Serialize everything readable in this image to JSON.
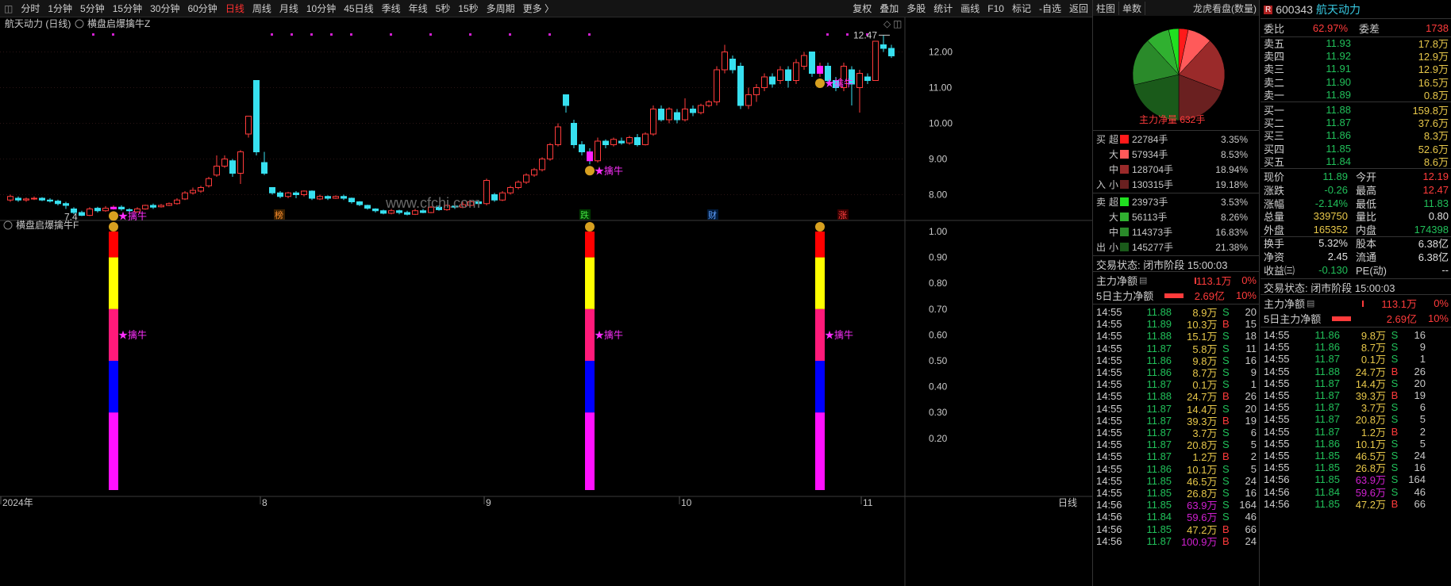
{
  "toolbar": {
    "periods": [
      "分时",
      "1分钟",
      "5分钟",
      "15分钟",
      "30分钟",
      "60分钟",
      "日线",
      "周线",
      "月线",
      "10分钟",
      "45日线",
      "季线",
      "年线",
      "5秒",
      "15秒",
      "多周期",
      "更多 〉"
    ],
    "active_index": 6,
    "right": [
      "复权",
      "叠加",
      "多股",
      "统计",
      "画线",
      "F10",
      "标记",
      "-自选",
      "返回"
    ]
  },
  "chart": {
    "title": "航天动力 (日线)",
    "indicator_main": "横盘启爆擒牛Z",
    "indicator_sub": "横盘启爆擒牛F",
    "signal_label": "★擒牛",
    "price_ticks": [
      "12.00",
      "11.00",
      "10.00",
      "9.00",
      "8.00"
    ],
    "sub_ticks": [
      "1.00",
      "0.90",
      "0.80",
      "0.70",
      "0.60",
      "0.50",
      "0.40",
      "0.30",
      "0.20"
    ],
    "x_labels": [
      "2024年",
      "8",
      "9",
      "10",
      "11"
    ],
    "period_label": "日线",
    "high_label": "12.47",
    "low_label": "7.4",
    "markers": [
      "榜",
      "跌",
      "财",
      "涨"
    ],
    "watermark": "www.cfchi.com"
  },
  "pie_panel": {
    "tabs": [
      "柱图",
      "单数"
    ],
    "title": "龙虎看盘(数量)",
    "net_label": "主力净量 632手"
  },
  "flow": {
    "buy_side": "买",
    "in_side": "入",
    "sell_side": "卖",
    "out_side": "出",
    "buy": [
      {
        "t": "超",
        "v": "22784手",
        "p": "3.35%",
        "c": "#ff1a1a"
      },
      {
        "t": "大",
        "v": "57934手",
        "p": "8.53%",
        "c": "#ff5a5a"
      },
      {
        "t": "中",
        "v": "128704手",
        "p": "18.94%",
        "c": "#9a2a2a"
      },
      {
        "t": "小",
        "v": "130315手",
        "p": "19.18%",
        "c": "#6a2020"
      }
    ],
    "sell": [
      {
        "t": "超",
        "v": "23973手",
        "p": "3.53%",
        "c": "#20e020"
      },
      {
        "t": "大",
        "v": "56113手",
        "p": "8.26%",
        "c": "#30b030"
      },
      {
        "t": "中",
        "v": "114373手",
        "p": "16.83%",
        "c": "#2a8a2a"
      },
      {
        "t": "小",
        "v": "145277手",
        "p": "21.38%",
        "c": "#1a5a1a"
      }
    ]
  },
  "mid_status": {
    "state": "交易状态: 闭市阶段 15:00:03",
    "net_label": "主力净额",
    "net_val": "113.1万",
    "net_pct": "0%",
    "net5_label": "5日主力净额",
    "net5_val": "2.69亿",
    "net5_pct": "10%"
  },
  "ticks_mid": [
    [
      "14:55",
      "11.88",
      "8.9万",
      "S",
      "20"
    ],
    [
      "14:55",
      "11.89",
      "10.3万",
      "B",
      "15"
    ],
    [
      "14:55",
      "11.88",
      "15.1万",
      "S",
      "18"
    ],
    [
      "14:55",
      "11.87",
      "5.8万",
      "S",
      "11"
    ],
    [
      "14:55",
      "11.86",
      "9.8万",
      "S",
      "16"
    ],
    [
      "14:55",
      "11.86",
      "8.7万",
      "S",
      "9"
    ],
    [
      "14:55",
      "11.87",
      "0.1万",
      "S",
      "1"
    ],
    [
      "14:55",
      "11.88",
      "24.7万",
      "B",
      "26"
    ],
    [
      "14:55",
      "11.87",
      "14.4万",
      "S",
      "20"
    ],
    [
      "14:55",
      "11.87",
      "39.3万",
      "B",
      "19"
    ],
    [
      "14:55",
      "11.87",
      "3.7万",
      "S",
      "6"
    ],
    [
      "14:55",
      "11.87",
      "20.8万",
      "S",
      "5"
    ],
    [
      "14:55",
      "11.87",
      "1.2万",
      "B",
      "2"
    ],
    [
      "14:55",
      "11.86",
      "10.1万",
      "S",
      "5"
    ],
    [
      "14:55",
      "11.85",
      "46.5万",
      "S",
      "24"
    ],
    [
      "14:55",
      "11.85",
      "26.8万",
      "S",
      "16"
    ],
    [
      "14:56",
      "11.85",
      "63.9万",
      "S",
      "164"
    ],
    [
      "14:56",
      "11.84",
      "59.6万",
      "S",
      "46"
    ],
    [
      "14:56",
      "11.85",
      "47.2万",
      "B",
      "66"
    ],
    [
      "14:56",
      "11.87",
      "100.9万",
      "B",
      "24"
    ]
  ],
  "stock": {
    "marker": "R",
    "code": "600343",
    "name": "航天动力",
    "weibi_label": "委比",
    "weibi": "62.97%",
    "weicha_label": "委差",
    "weicha": "1738"
  },
  "asks": [
    [
      "卖五",
      "11.93",
      "17.8万"
    ],
    [
      "卖四",
      "11.92",
      "12.9万"
    ],
    [
      "卖三",
      "11.91",
      "12.9万"
    ],
    [
      "卖二",
      "11.90",
      "16.5万"
    ],
    [
      "卖一",
      "11.89",
      "0.8万"
    ]
  ],
  "bids": [
    [
      "买一",
      "11.88",
      "159.8万"
    ],
    [
      "买二",
      "11.87",
      "37.6万"
    ],
    [
      "买三",
      "11.86",
      "8.3万"
    ],
    [
      "买四",
      "11.85",
      "52.6万"
    ],
    [
      "买五",
      "11.84",
      "8.6万"
    ]
  ],
  "quote": [
    [
      "现价",
      "11.89",
      "今开",
      "12.19"
    ],
    [
      "涨跌",
      "-0.26",
      "最高",
      "12.47"
    ],
    [
      "涨幅",
      "-2.14%",
      "最低",
      "11.83"
    ],
    [
      "总量",
      "339750",
      "量比",
      "0.80"
    ],
    [
      "外盘",
      "165352",
      "内盘",
      "174398"
    ],
    [
      "换手",
      "5.32%",
      "股本",
      "6.38亿"
    ],
    [
      "净资",
      "2.45",
      "流通",
      "6.38亿"
    ],
    [
      "收益㈢",
      "-0.130",
      "PE(动)",
      "--"
    ]
  ],
  "right_status": {
    "state": "交易状态: 闭市阶段 15:00:03",
    "net_label": "主力净额",
    "net_val": "113.1万",
    "net_pct": "0%",
    "net5_label": "5日主力净额",
    "net5_val": "2.69亿",
    "net5_pct": "10%"
  },
  "ticks_right": [
    [
      "14:55",
      "11.86",
      "9.8万",
      "S",
      "16"
    ],
    [
      "14:55",
      "11.86",
      "8.7万",
      "S",
      "9"
    ],
    [
      "14:55",
      "11.87",
      "0.1万",
      "S",
      "1"
    ],
    [
      "14:55",
      "11.88",
      "24.7万",
      "B",
      "26"
    ],
    [
      "14:55",
      "11.87",
      "14.4万",
      "S",
      "20"
    ],
    [
      "14:55",
      "11.87",
      "39.3万",
      "B",
      "19"
    ],
    [
      "14:55",
      "11.87",
      "3.7万",
      "S",
      "6"
    ],
    [
      "14:55",
      "11.87",
      "20.8万",
      "S",
      "5"
    ],
    [
      "14:55",
      "11.87",
      "1.2万",
      "B",
      "2"
    ],
    [
      "14:55",
      "11.86",
      "10.1万",
      "S",
      "5"
    ],
    [
      "14:55",
      "11.85",
      "46.5万",
      "S",
      "24"
    ],
    [
      "14:55",
      "11.85",
      "26.8万",
      "S",
      "16"
    ],
    [
      "14:56",
      "11.85",
      "63.9万",
      "S",
      "164"
    ],
    [
      "14:56",
      "11.84",
      "59.6万",
      "S",
      "46"
    ],
    [
      "14:56",
      "11.85",
      "47.2万",
      "B",
      "66"
    ]
  ],
  "chart_data": {
    "type": "candlestick",
    "ylim": [
      7.3,
      12.7
    ],
    "candles": [
      [
        7.85,
        7.95,
        8.0,
        7.8
      ],
      [
        7.9,
        7.85,
        7.95,
        7.8
      ],
      [
        7.85,
        7.88,
        7.92,
        7.8
      ],
      [
        7.88,
        7.9,
        7.95,
        7.85
      ],
      [
        7.9,
        7.85,
        7.93,
        7.82
      ],
      [
        7.85,
        7.82,
        7.9,
        7.78
      ],
      [
        7.82,
        7.75,
        7.86,
        7.7
      ],
      [
        7.75,
        7.7,
        7.8,
        7.6
      ],
      [
        7.6,
        7.5,
        7.65,
        7.45
      ],
      [
        7.5,
        7.42,
        7.55,
        7.4
      ],
      [
        7.42,
        7.6,
        7.65,
        7.4
      ],
      [
        7.62,
        7.55,
        7.66,
        7.5
      ],
      [
        7.55,
        7.62,
        7.68,
        7.52
      ],
      [
        7.6,
        7.65,
        7.7,
        7.58
      ],
      [
        7.65,
        7.6,
        7.7,
        7.55
      ],
      [
        7.58,
        7.55,
        7.62,
        7.5
      ],
      [
        7.52,
        7.6,
        7.65,
        7.5
      ],
      [
        7.6,
        7.7,
        7.72,
        7.58
      ],
      [
        7.7,
        7.65,
        7.75,
        7.6
      ],
      [
        7.66,
        7.7,
        7.74,
        7.64
      ],
      [
        7.7,
        7.75,
        7.78,
        7.68
      ],
      [
        7.75,
        7.85,
        7.9,
        7.72
      ],
      [
        7.88,
        8.05,
        8.1,
        7.85
      ],
      [
        8.05,
        8.12,
        8.2,
        8.0
      ],
      [
        8.1,
        8.2,
        8.25,
        8.05
      ],
      [
        8.25,
        8.45,
        8.5,
        8.2
      ],
      [
        8.55,
        8.8,
        9.1,
        8.5
      ],
      [
        8.8,
        9.0,
        9.1,
        8.75
      ],
      [
        8.95,
        8.6,
        9.0,
        8.5
      ],
      [
        8.6,
        9.2,
        9.25,
        8.3
      ],
      [
        9.7,
        10.2,
        10.2,
        9.6
      ],
      [
        11.2,
        9.2,
        11.2,
        9.1
      ],
      [
        8.9,
        8.6,
        9.2,
        8.55
      ],
      [
        8.2,
        8.05,
        8.2,
        8.0
      ],
      [
        8.05,
        7.95,
        8.1,
        7.9
      ],
      [
        7.95,
        8.05,
        8.08,
        7.9
      ],
      [
        8.05,
        8.0,
        8.1,
        7.9
      ],
      [
        8.0,
        8.1,
        8.12,
        7.95
      ],
      [
        8.1,
        7.9,
        8.12,
        7.85
      ],
      [
        7.88,
        7.95,
        8.0,
        7.85
      ],
      [
        7.95,
        7.9,
        7.98,
        7.85
      ],
      [
        7.9,
        7.95,
        7.98,
        7.88
      ],
      [
        7.95,
        7.9,
        8.0,
        7.85
      ],
      [
        7.9,
        7.8,
        7.92,
        7.75
      ],
      [
        7.8,
        7.72,
        7.82,
        7.68
      ],
      [
        7.7,
        7.62,
        7.72,
        7.58
      ],
      [
        7.6,
        7.55,
        7.62,
        7.5
      ],
      [
        7.55,
        7.48,
        7.58,
        7.45
      ],
      [
        7.48,
        7.55,
        7.6,
        7.45
      ],
      [
        7.55,
        7.5,
        7.58,
        7.45
      ],
      [
        7.5,
        7.45,
        7.55,
        7.42
      ],
      [
        7.45,
        7.55,
        7.6,
        7.43
      ],
      [
        7.55,
        7.5,
        7.6,
        7.48
      ],
      [
        7.5,
        7.65,
        7.68,
        7.48
      ],
      [
        7.65,
        7.58,
        7.7,
        7.55
      ],
      [
        7.58,
        7.7,
        7.72,
        7.55
      ],
      [
        7.68,
        7.65,
        7.75,
        7.6
      ],
      [
        7.65,
        7.72,
        7.8,
        7.62
      ],
      [
        7.7,
        7.8,
        7.85,
        7.68
      ],
      [
        7.8,
        7.75,
        7.85,
        7.7
      ],
      [
        7.75,
        8.4,
        8.45,
        7.7
      ],
      [
        8.0,
        7.85,
        8.05,
        7.8
      ],
      [
        7.85,
        8.05,
        8.1,
        7.82
      ],
      [
        8.05,
        8.2,
        8.25,
        8.0
      ],
      [
        8.2,
        8.35,
        8.4,
        8.15
      ],
      [
        8.35,
        8.55,
        8.6,
        8.3
      ],
      [
        8.55,
        8.7,
        8.75,
        8.5
      ],
      [
        8.7,
        9.0,
        9.05,
        8.65
      ],
      [
        9.0,
        9.4,
        9.45,
        8.95
      ],
      [
        9.4,
        9.9,
        10.0,
        9.35
      ],
      [
        10.8,
        10.5,
        10.8,
        10.3
      ],
      [
        10.0,
        9.4,
        10.1,
        9.3
      ],
      [
        9.4,
        9.2,
        9.5,
        9.1
      ],
      [
        9.2,
        8.95,
        9.3,
        8.85
      ],
      [
        8.95,
        9.5,
        9.6,
        8.9
      ],
      [
        9.5,
        9.4,
        9.55,
        9.3
      ],
      [
        9.4,
        9.55,
        9.6,
        9.35
      ],
      [
        9.5,
        9.45,
        9.6,
        9.4
      ],
      [
        9.45,
        9.6,
        9.65,
        9.4
      ],
      [
        9.6,
        9.4,
        9.7,
        9.35
      ],
      [
        9.4,
        9.7,
        9.75,
        9.38
      ],
      [
        9.7,
        10.4,
        10.5,
        9.65
      ],
      [
        10.4,
        10.1,
        10.5,
        10.05
      ],
      [
        10.1,
        10.4,
        10.45,
        10.0
      ],
      [
        10.3,
        10.1,
        10.4,
        10.0
      ],
      [
        10.1,
        10.4,
        10.7,
        10.05
      ],
      [
        10.4,
        10.3,
        10.5,
        10.2
      ],
      [
        10.3,
        10.5,
        10.55,
        10.25
      ],
      [
        10.5,
        10.6,
        10.65,
        10.45
      ],
      [
        10.6,
        11.5,
        11.6,
        10.5
      ],
      [
        11.5,
        12.0,
        12.2,
        11.4
      ],
      [
        11.8,
        11.5,
        11.9,
        11.4
      ],
      [
        11.6,
        10.5,
        11.7,
        10.4
      ],
      [
        10.5,
        10.8,
        11.0,
        10.4
      ],
      [
        10.8,
        11.0,
        11.1,
        10.6
      ],
      [
        11.0,
        11.3,
        11.4,
        10.9
      ],
      [
        11.3,
        11.1,
        11.4,
        11.0
      ],
      [
        11.2,
        11.5,
        11.6,
        11.1
      ],
      [
        11.5,
        11.2,
        11.6,
        11.0
      ],
      [
        11.2,
        11.7,
        11.8,
        11.1
      ],
      [
        11.6,
        11.9,
        12.0,
        11.5
      ],
      [
        12.0,
        11.4,
        12.0,
        11.3
      ],
      [
        11.4,
        11.6,
        11.7,
        11.3
      ],
      [
        11.6,
        11.2,
        11.7,
        11.1
      ],
      [
        11.2,
        11.0,
        11.3,
        10.9
      ],
      [
        11.0,
        11.6,
        11.7,
        10.9
      ],
      [
        11.5,
        11.1,
        11.6,
        10.5
      ],
      [
        11.0,
        11.4,
        11.5,
        10.3
      ],
      [
        11.3,
        11.2,
        11.4,
        11.1
      ],
      [
        11.2,
        12.3,
        12.3,
        11.2
      ],
      [
        12.2,
        12.1,
        12.47,
        12.0
      ],
      [
        12.1,
        11.89,
        12.2,
        11.83
      ]
    ],
    "signal_bars": [
      [
        13,
        [
          1,
          0.9
        ],
        [
          0.9,
          0.7
        ],
        [
          0.7,
          0.5
        ],
        [
          0.5,
          0.3
        ],
        [
          0.3,
          0
        ]
      ],
      [
        73,
        [
          1,
          0.9
        ],
        [
          0.9,
          0.7
        ],
        [
          0.7,
          0.5
        ],
        [
          0.5,
          0.3
        ],
        [
          0.3,
          0
        ]
      ],
      [
        102,
        [
          1,
          0.9
        ],
        [
          0.9,
          0.7
        ],
        [
          0.7,
          0.5
        ],
        [
          0.5,
          0.3
        ],
        [
          0.3,
          0
        ]
      ]
    ]
  }
}
